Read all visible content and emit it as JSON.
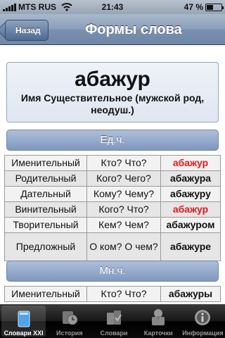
{
  "status_bar": {
    "carrier": "MTS RUS",
    "time": "21:43",
    "battery_pct": "47 %",
    "battery_level": 0.47
  },
  "nav": {
    "back_label": "Назад",
    "title": "Формы слова"
  },
  "word": {
    "headword": "абажур",
    "part_of_speech": "Имя Существительное (мужской род, неодуш.)"
  },
  "singular": {
    "header": "Ед.ч.",
    "rows": [
      {
        "case": "Именительный",
        "question": "Кто? Что?",
        "form": "абажур",
        "highlight": true
      },
      {
        "case": "Родительный",
        "question": "Кого? Чего?",
        "form": "абажура",
        "highlight": false
      },
      {
        "case": "Дательный",
        "question": "Кому? Чему?",
        "form": "абажуру",
        "highlight": false
      },
      {
        "case": "Винительный",
        "question": "Кого? Что?",
        "form": "абажур",
        "highlight": true
      },
      {
        "case": "Творительный",
        "question": "Кем? Чем?",
        "form": "абажуром",
        "highlight": false
      },
      {
        "case": "Предложный",
        "question": "О ком? О чем?",
        "form": "абажуре",
        "highlight": false
      }
    ]
  },
  "plural": {
    "header": "Мн.ч.",
    "rows": [
      {
        "case": "Именительный",
        "question": "Кто? Что?",
        "form": "абажуры",
        "highlight": false
      }
    ]
  },
  "tabs": [
    {
      "label": "Словари XXI",
      "icon": "book-icon",
      "active": true
    },
    {
      "label": "История",
      "icon": "history-icon",
      "active": false
    },
    {
      "label": "Словари",
      "icon": "dictionaries-icon",
      "active": false
    },
    {
      "label": "Карточки",
      "icon": "cards-icon",
      "active": false
    },
    {
      "label": "Информация",
      "icon": "info-icon",
      "active": false
    }
  ],
  "colors": {
    "highlight": "#e41a1a",
    "nav_bar": "#7a90af",
    "section_header": "#8da3c8"
  }
}
